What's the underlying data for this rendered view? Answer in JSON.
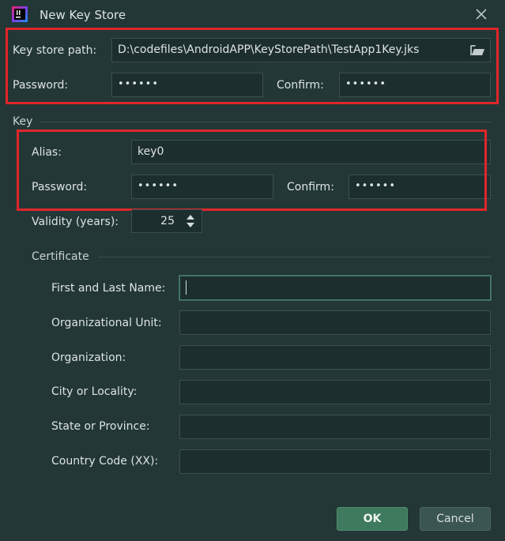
{
  "window": {
    "title": "New Key Store",
    "app_icon": "intellij-idea-icon",
    "close_icon": "close-icon"
  },
  "keystore": {
    "path_label": "Key store path:",
    "path_value": "D:\\codefiles\\AndroidAPP\\KeyStorePath\\TestApp1Key.jks",
    "browse_icon": "folder-open-icon",
    "password_label": "Password:",
    "password_value": "••••••",
    "confirm_label": "Confirm:",
    "confirm_value": "••••••"
  },
  "key": {
    "section_title": "Key",
    "alias_label": "Alias:",
    "alias_value": "key0",
    "password_label": "Password:",
    "password_value": "••••••",
    "confirm_label": "Confirm:",
    "confirm_value": "••••••",
    "validity_label": "Validity (years):",
    "validity_value": "25"
  },
  "certificate": {
    "section_title": "Certificate",
    "fields": [
      {
        "label": "First and Last Name:",
        "value": ""
      },
      {
        "label": "Organizational Unit:",
        "value": ""
      },
      {
        "label": "Organization:",
        "value": ""
      },
      {
        "label": "City or Locality:",
        "value": ""
      },
      {
        "label": "State or Province:",
        "value": ""
      },
      {
        "label": "Country Code (XX):",
        "value": ""
      }
    ]
  },
  "buttons": {
    "ok_label": "OK",
    "cancel_label": "Cancel"
  },
  "colors": {
    "background": "#233737",
    "field_bg": "#1c2e2e",
    "highlight_box": "#e0262a",
    "ok_button": "#3f7a5e"
  }
}
